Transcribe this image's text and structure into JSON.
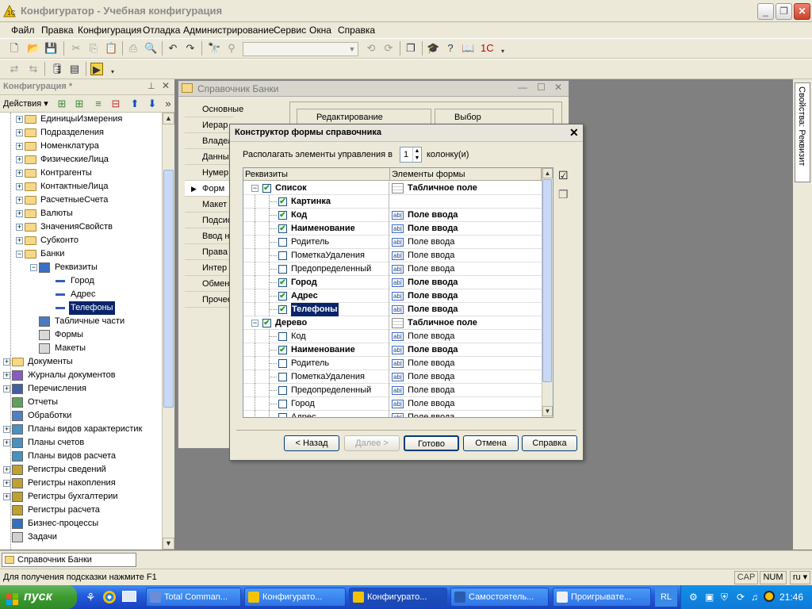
{
  "window": {
    "title": "Конфигуратор - Учебная конфигурация"
  },
  "menu": [
    "Файл",
    "Правка",
    "Конфигурация",
    "Отладка",
    "Администрирование",
    "Сервис",
    "Окна",
    "Справка"
  ],
  "left_panel": {
    "title": "Конфигурация *",
    "actions_label": "Действия",
    "tree": [
      {
        "label": "ЕдиницыИзмерения",
        "level": 2,
        "kind": "folder",
        "expander": "+"
      },
      {
        "label": "Подразделения",
        "level": 2,
        "kind": "folder",
        "expander": "+"
      },
      {
        "label": "Номенклатура",
        "level": 2,
        "kind": "folder",
        "expander": "+"
      },
      {
        "label": "ФизическиеЛица",
        "level": 2,
        "kind": "folder",
        "expander": "+"
      },
      {
        "label": "Контрагенты",
        "level": 2,
        "kind": "folder",
        "expander": "+"
      },
      {
        "label": "КонтактныеЛица",
        "level": 2,
        "kind": "folder",
        "expander": "+"
      },
      {
        "label": "РасчетныеСчета",
        "level": 2,
        "kind": "folder",
        "expander": "+"
      },
      {
        "label": "Валюты",
        "level": 2,
        "kind": "folder",
        "expander": "+"
      },
      {
        "label": "ЗначенияСвойств",
        "level": 2,
        "kind": "folder",
        "expander": "+"
      },
      {
        "label": "Субконто",
        "level": 2,
        "kind": "folder",
        "expander": "+"
      },
      {
        "label": "Банки",
        "level": 2,
        "kind": "folder",
        "expander": "-"
      },
      {
        "label": "Реквизиты",
        "level": 3,
        "kind": "props",
        "expander": "-"
      },
      {
        "label": "Город",
        "level": 4,
        "kind": "leaf"
      },
      {
        "label": "Адрес",
        "level": 4,
        "kind": "leaf"
      },
      {
        "label": "Телефоны",
        "level": 4,
        "kind": "leaf",
        "selected": true
      },
      {
        "label": "Табличные части",
        "level": 3,
        "kind": "tables"
      },
      {
        "label": "Формы",
        "level": 3,
        "kind": "forms"
      },
      {
        "label": "Макеты",
        "level": 3,
        "kind": "templates"
      },
      {
        "label": "Документы",
        "level": 1,
        "kind": "folder",
        "expander": "+"
      },
      {
        "label": "Журналы документов",
        "level": 1,
        "kind": "journal",
        "expander": "+"
      },
      {
        "label": "Перечисления",
        "level": 1,
        "kind": "enum",
        "expander": "+"
      },
      {
        "label": "Отчеты",
        "level": 1,
        "kind": "report"
      },
      {
        "label": "Обработки",
        "level": 1,
        "kind": "proc"
      },
      {
        "label": "Планы видов характеристик",
        "level": 1,
        "kind": "plan",
        "expander": "+"
      },
      {
        "label": "Планы счетов",
        "level": 1,
        "kind": "plan",
        "expander": "+"
      },
      {
        "label": "Планы видов расчета",
        "level": 1,
        "kind": "plan"
      },
      {
        "label": "Регистры сведений",
        "level": 1,
        "kind": "reg",
        "expander": "+"
      },
      {
        "label": "Регистры накопления",
        "level": 1,
        "kind": "reg",
        "expander": "+"
      },
      {
        "label": "Регистры бухгалтерии",
        "level": 1,
        "kind": "reg",
        "expander": "+"
      },
      {
        "label": "Регистры расчета",
        "level": 1,
        "kind": "reg"
      },
      {
        "label": "Бизнес-процессы",
        "level": 1,
        "kind": "bp"
      },
      {
        "label": "Задачи",
        "level": 1,
        "kind": "task"
      }
    ]
  },
  "bg_window": {
    "title": "Справочник Банки",
    "tabs": [
      "Основные",
      "Иерар",
      "Владел",
      "Данны",
      "Нумер",
      "Форм",
      "Макет",
      "Подсис",
      "Ввод н",
      "Права",
      "Интер",
      "Обмен",
      "Прочее"
    ],
    "active_tab_index": 5,
    "group_edit": "Редактирование",
    "group_select": "Выбор"
  },
  "dialog": {
    "title": "Конструктор формы справочника",
    "columns_prefix": "Располагать элементы управления в",
    "columns_value": "1",
    "columns_suffix": "колонку(и)",
    "header_left": "Реквизиты",
    "header_right": "Элементы формы",
    "rows": [
      {
        "label": "Список",
        "level": 0,
        "checked": true,
        "bold": true,
        "element": "Табличное поле",
        "el_bold": true,
        "kind": "table",
        "expander": "-"
      },
      {
        "label": "Картинка",
        "level": 1,
        "checked": true,
        "bold": true,
        "element": "",
        "el_bold": false,
        "kind": "none"
      },
      {
        "label": "Код",
        "level": 1,
        "checked": true,
        "bold": true,
        "element": "Поле ввода",
        "el_bold": true,
        "kind": "input"
      },
      {
        "label": "Наименование",
        "level": 1,
        "checked": true,
        "bold": true,
        "element": "Поле ввода",
        "el_bold": true,
        "kind": "input"
      },
      {
        "label": "Родитель",
        "level": 1,
        "checked": false,
        "bold": false,
        "element": "Поле ввода",
        "el_bold": false,
        "kind": "input"
      },
      {
        "label": "ПометкаУдаления",
        "level": 1,
        "checked": false,
        "bold": false,
        "element": "Поле ввода",
        "el_bold": false,
        "kind": "input"
      },
      {
        "label": "Предопределенный",
        "level": 1,
        "checked": false,
        "bold": false,
        "element": "Поле ввода",
        "el_bold": false,
        "kind": "input"
      },
      {
        "label": "Город",
        "level": 1,
        "checked": true,
        "bold": true,
        "element": "Поле ввода",
        "el_bold": true,
        "kind": "input"
      },
      {
        "label": "Адрес",
        "level": 1,
        "checked": true,
        "bold": true,
        "element": "Поле ввода",
        "el_bold": true,
        "kind": "input"
      },
      {
        "label": "Телефоны",
        "level": 1,
        "checked": true,
        "bold": true,
        "element": "Поле ввода",
        "el_bold": true,
        "kind": "input",
        "selected": true
      },
      {
        "label": "Дерево",
        "level": 0,
        "checked": true,
        "bold": true,
        "element": "Табличное поле",
        "el_bold": true,
        "kind": "table",
        "expander": "-"
      },
      {
        "label": "Код",
        "level": 1,
        "checked": false,
        "bold": false,
        "element": "Поле ввода",
        "el_bold": false,
        "kind": "input"
      },
      {
        "label": "Наименование",
        "level": 1,
        "checked": true,
        "bold": true,
        "element": "Поле ввода",
        "el_bold": true,
        "kind": "input"
      },
      {
        "label": "Родитель",
        "level": 1,
        "checked": false,
        "bold": false,
        "element": "Поле ввода",
        "el_bold": false,
        "kind": "input"
      },
      {
        "label": "ПометкаУдаления",
        "level": 1,
        "checked": false,
        "bold": false,
        "element": "Поле ввода",
        "el_bold": false,
        "kind": "input"
      },
      {
        "label": "Предопределенный",
        "level": 1,
        "checked": false,
        "bold": false,
        "element": "Поле ввода",
        "el_bold": false,
        "kind": "input"
      },
      {
        "label": "Город",
        "level": 1,
        "checked": false,
        "bold": false,
        "element": "Поле ввода",
        "el_bold": false,
        "kind": "input"
      },
      {
        "label": "Адрес",
        "level": 1,
        "checked": false,
        "bold": false,
        "element": "Поле ввода",
        "el_bold": false,
        "kind": "input"
      }
    ],
    "buttons": {
      "back": "< Назад",
      "next": "Далее >",
      "done": "Готово",
      "cancel": "Отмена",
      "help": "Справка"
    }
  },
  "right_sidebar": {
    "tab_label": "Свойства: Реквизит"
  },
  "bottom_tab": "Справочник Банки",
  "status": {
    "hint": "Для получения подсказки нажмите F1",
    "caps": "CAP",
    "num": "NUM",
    "lang": "ru"
  },
  "taskbar": {
    "start": "пуск",
    "tasks": [
      "Total Comman...",
      "Конфигурато...",
      "Конфигурато...",
      "Самостоятель...",
      "Проигрывате..."
    ],
    "active_task_index": 2,
    "lang": "RL",
    "clock": "21:46"
  },
  "colors": {
    "selection": "#0a246a",
    "xp_blue": "#245edb",
    "start_green": "#3c9a30"
  }
}
